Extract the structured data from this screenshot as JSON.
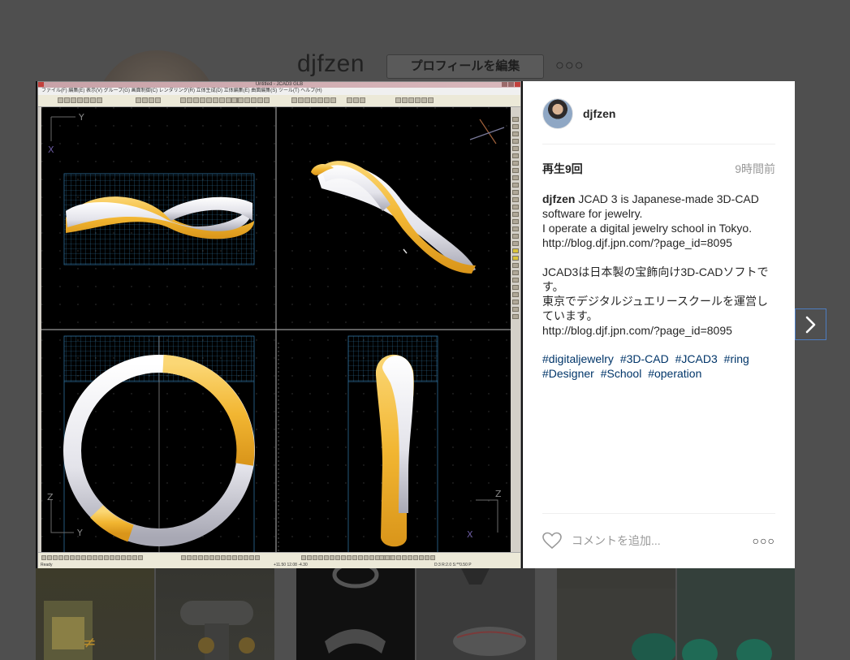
{
  "background": {
    "username": "djfzen",
    "edit_profile_label": "プロフィールを編集",
    "options_label": "○○○"
  },
  "modal": {
    "header": {
      "username": "djfzen"
    },
    "views": "再生9回",
    "time": "9時間前",
    "caption": {
      "username": "djfzen",
      "text": " JCAD 3 is Japanese-made 3D-CAD software for jewelry.\nI operate a digital jewelry school in Tokyo.\nhttp://blog.djf.jpn.com/?page_id=8095\n\nJCAD3は日本製の宝飾向け3D-CADソフトです。\n東京でデジタルジュエリースクールを運営しています。\nhttp://blog.djf.jpn.com/?page_id=8095"
    },
    "hashtags": [
      "#digitaljewelry",
      "#3D-CAD",
      "#JCAD3",
      "#ring",
      "#Designer",
      "#School",
      "#operation"
    ],
    "comment_placeholder": "コメントを追加...",
    "more_label": "○○○"
  },
  "cad": {
    "title": "Untitled - JCAD3 GLB",
    "menu": "ファイル(F)  編集(E)  表示(V)  グループ(G)  画面制御(C)  レンダリング(R)  立体生成(D)  立体編集(E)  曲面編集(S)  ツール(T)  ヘルプ(H)",
    "status_left": "Ready",
    "status_mid": "+11.50  12.08  -4.30",
    "status_right": "D:3 R:2.0  S:**0.50 P"
  },
  "colors": {
    "gold": "#f2b632",
    "silver": "#e8e8ee",
    "grid": "#2f6f9a",
    "link": "#003569",
    "accent_border": "#4d7cc0"
  }
}
